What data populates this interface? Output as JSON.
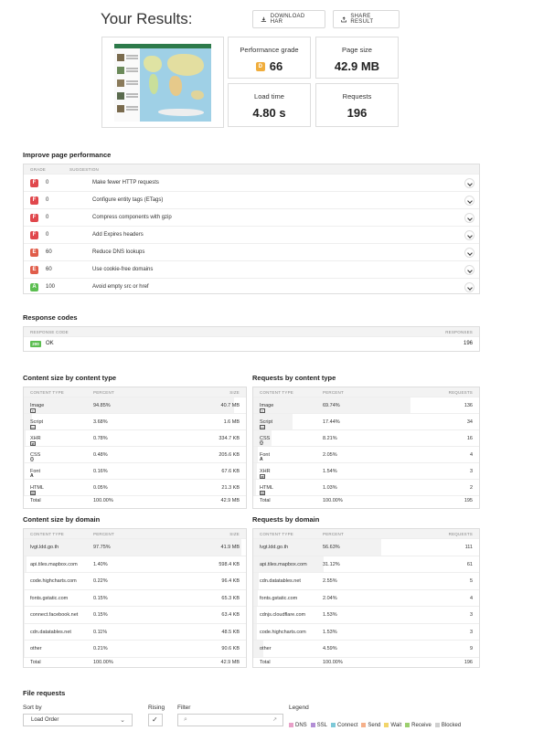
{
  "header": {
    "title": "Your Results:",
    "download_label": "DOWNLOAD HAR",
    "share_label": "SHARE RESULT"
  },
  "metrics": {
    "grade_label": "Performance grade",
    "grade_letter": "D",
    "grade_value": "66",
    "size_label": "Page size",
    "size_value": "42.9 MB",
    "load_label": "Load time",
    "load_value": "4.80 s",
    "requests_label": "Requests",
    "requests_value": "196"
  },
  "improve": {
    "title": "Improve page performance",
    "col_grade": "GRADE",
    "col_suggestion": "SUGGESTION",
    "rows": [
      {
        "grade": "F",
        "score": "0",
        "suggestion": "Make fewer HTTP requests",
        "color": "#e0474c"
      },
      {
        "grade": "F",
        "score": "0",
        "suggestion": "Configure entity tags (ETags)",
        "color": "#e0474c"
      },
      {
        "grade": "F",
        "score": "0",
        "suggestion": "Compress components with gzip",
        "color": "#e0474c"
      },
      {
        "grade": "F",
        "score": "0",
        "suggestion": "Add Expires headers",
        "color": "#e0474c"
      },
      {
        "grade": "E",
        "score": "60",
        "suggestion": "Reduce DNS lookups",
        "color": "#e05d4a"
      },
      {
        "grade": "E",
        "score": "60",
        "suggestion": "Use cookie-free domains",
        "color": "#e05d4a"
      },
      {
        "grade": "A",
        "score": "100",
        "suggestion": "Avoid empty src or href",
        "color": "#5bbe50"
      }
    ]
  },
  "response": {
    "title": "Response codes",
    "col_code": "RESPONSE CODE",
    "col_responses": "RESPONSES",
    "code": "200",
    "status": "OK",
    "count": "196"
  },
  "size_type": {
    "title": "Content size by content type",
    "cols": [
      "CONTENT TYPE",
      "PERCENT",
      "SIZE"
    ],
    "rows": [
      {
        "icon": "image-icon",
        "glyph": "▪",
        "name": "Image",
        "percent": "94.85%",
        "value": "40.7 MB",
        "pct": 94.85
      },
      {
        "icon": "script-icon",
        "glyph": "▭",
        "name": "Script",
        "percent": "3.68%",
        "value": "1.6 MB",
        "pct": 3.68
      },
      {
        "icon": "xhr-icon",
        "glyph": "⇄",
        "name": "XHR",
        "percent": "0.78%",
        "value": "334.7 KB",
        "pct": 0.78
      },
      {
        "icon": "css-icon",
        "glyph": "{}",
        "name": "CSS",
        "percent": "0.48%",
        "value": "205.6 KB",
        "pct": 0.48
      },
      {
        "icon": "font-icon",
        "glyph": "A",
        "name": "Font",
        "percent": "0.16%",
        "value": "67.6 KB",
        "pct": 0.16
      },
      {
        "icon": "html-icon",
        "glyph": "▤",
        "name": "HTML",
        "percent": "0.05%",
        "value": "21.3 KB",
        "pct": 0.05
      }
    ],
    "total": {
      "name": "Total",
      "percent": "100.00%",
      "value": "42.9 MB"
    }
  },
  "req_type": {
    "title": "Requests by content type",
    "cols": [
      "CONTENT TYPE",
      "PERCENT",
      "REQUESTS"
    ],
    "rows": [
      {
        "icon": "image-icon",
        "glyph": "▪",
        "name": "Image",
        "percent": "69.74%",
        "value": "136",
        "pct": 69.74
      },
      {
        "icon": "script-icon",
        "glyph": "▭",
        "name": "Script",
        "percent": "17.44%",
        "value": "34",
        "pct": 17.44
      },
      {
        "icon": "css-icon",
        "glyph": "{}",
        "name": "CSS",
        "percent": "8.21%",
        "value": "16",
        "pct": 8.21
      },
      {
        "icon": "font-icon",
        "glyph": "A",
        "name": "Font",
        "percent": "2.05%",
        "value": "4",
        "pct": 2.05
      },
      {
        "icon": "xhr-icon",
        "glyph": "⇄",
        "name": "XHR",
        "percent": "1.54%",
        "value": "3",
        "pct": 1.54
      },
      {
        "icon": "html-icon",
        "glyph": "▤",
        "name": "HTML",
        "percent": "1.03%",
        "value": "2",
        "pct": 1.03
      }
    ],
    "total": {
      "name": "Total",
      "percent": "100.00%",
      "value": "195"
    }
  },
  "size_domain": {
    "title": "Content size by domain",
    "cols": [
      "CONTENT TYPE",
      "PERCENT",
      "SIZE"
    ],
    "rows": [
      {
        "name": "lvgt.ldd.go.th",
        "percent": "97.75%",
        "value": "41.9 MB",
        "pct": 97.75
      },
      {
        "name": "api.tiles.mapbox.com",
        "percent": "1.40%",
        "value": "598.4 KB",
        "pct": 1.4
      },
      {
        "name": "code.highcharts.com",
        "percent": "0.22%",
        "value": "96.4 KB",
        "pct": 0.22
      },
      {
        "name": "fonts.gstatic.com",
        "percent": "0.15%",
        "value": "65.3 KB",
        "pct": 0.15
      },
      {
        "name": "connect.facebook.net",
        "percent": "0.15%",
        "value": "63.4 KB",
        "pct": 0.15
      },
      {
        "name": "cdn.datatables.net",
        "percent": "0.11%",
        "value": "48.5 KB",
        "pct": 0.11
      },
      {
        "name": "other",
        "percent": "0.21%",
        "value": "90.6 KB",
        "pct": 0.21
      }
    ],
    "total": {
      "name": "Total",
      "percent": "100.00%",
      "value": "42.9 MB"
    }
  },
  "req_domain": {
    "title": "Requests by domain",
    "cols": [
      "CONTENT TYPE",
      "PERCENT",
      "REQUESTS"
    ],
    "rows": [
      {
        "name": "lvgt.ldd.go.th",
        "percent": "56.63%",
        "value": "111",
        "pct": 56.63
      },
      {
        "name": "api.tiles.mapbox.com",
        "percent": "31.12%",
        "value": "61",
        "pct": 31.12
      },
      {
        "name": "cdn.datatables.net",
        "percent": "2.55%",
        "value": "5",
        "pct": 2.55
      },
      {
        "name": "fonts.gstatic.com",
        "percent": "2.04%",
        "value": "4",
        "pct": 2.04
      },
      {
        "name": "cdnjs.cloudflare.com",
        "percent": "1.53%",
        "value": "3",
        "pct": 1.53
      },
      {
        "name": "code.highcharts.com",
        "percent": "1.53%",
        "value": "3",
        "pct": 1.53
      },
      {
        "name": "other",
        "percent": "4.59%",
        "value": "9",
        "pct": 4.59
      }
    ],
    "total": {
      "name": "Total",
      "percent": "100.00%",
      "value": "196"
    }
  },
  "file_requests": {
    "title": "File requests",
    "sort_label": "Sort by",
    "sort_value": "Load Order",
    "rising_label": "Rising",
    "filter_label": "Filter",
    "legend_label": "Legend",
    "legend": [
      {
        "name": "DNS",
        "color": "#e8a0c8"
      },
      {
        "name": "SSL",
        "color": "#b38fd6"
      },
      {
        "name": "Connect",
        "color": "#7ec9d8"
      },
      {
        "name": "Send",
        "color": "#f5b08a"
      },
      {
        "name": "Wait",
        "color": "#f2d56b"
      },
      {
        "name": "Receive",
        "color": "#9ccf6e"
      },
      {
        "name": "Blocked",
        "color": "#cfcfcf"
      }
    ]
  }
}
